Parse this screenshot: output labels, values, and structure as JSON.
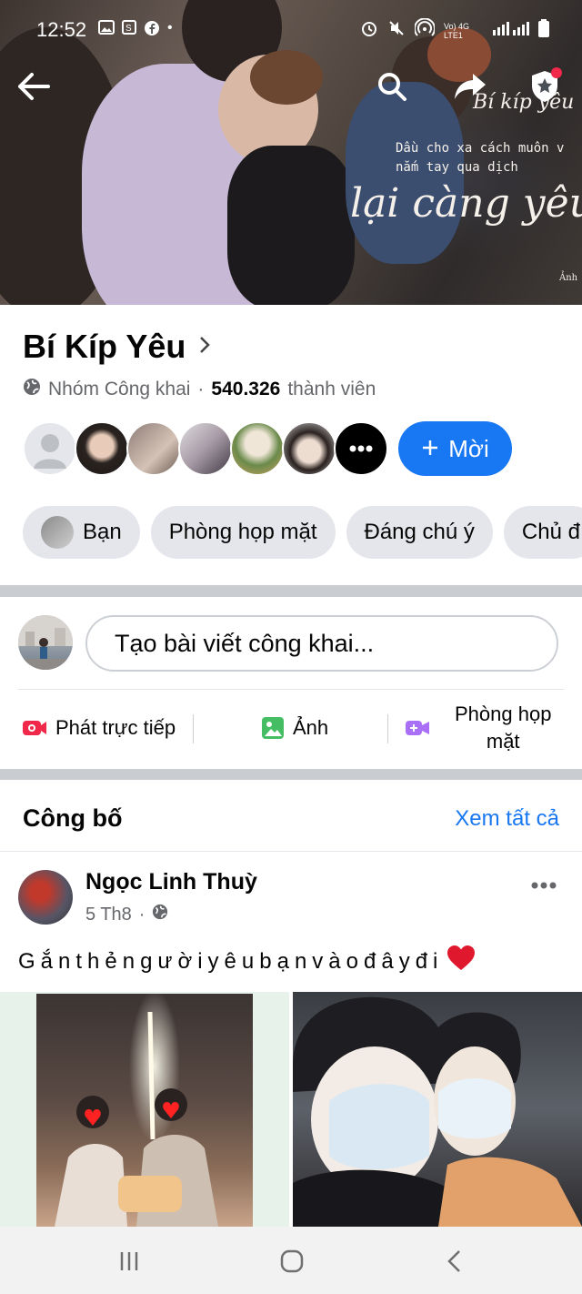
{
  "status_bar": {
    "time": "12:52",
    "network": "Vo) 4G LTE1"
  },
  "cover": {
    "script_title": "Bí kíp yêu",
    "line1": "Dầu cho xa cách muôn v",
    "line2": "nắm tay qua dịch",
    "line3": "lại càng yêu thư",
    "credit": "Ảnh"
  },
  "group": {
    "name": "Bí Kíp Yêu",
    "privacy": "Nhóm Công khai",
    "separator": "·",
    "member_count": "540.326",
    "member_label": "thành viên",
    "invite_label": "Mời"
  },
  "chips": [
    "Bạn",
    "Phòng họp mặt",
    "Đáng chú ý",
    "Chủ đ"
  ],
  "composer": {
    "placeholder": "Tạo bài viết công khai...",
    "actions": {
      "live": "Phát trực tiếp",
      "photo": "Ảnh",
      "room_line1": "Phòng họp",
      "room_line2": "mặt"
    }
  },
  "announcements": {
    "title": "Công bố",
    "see_all": "Xem tất cả"
  },
  "post": {
    "author": "Ngọc Linh Thuỳ",
    "date": "5 Th8",
    "text": "Gắnthẻngườiyêubạnvàođâyđi"
  },
  "colors": {
    "accent": "#1877f2",
    "chip_bg": "#e4e6eb",
    "live_red": "#f02849",
    "photo_green": "#45bd62",
    "room_purple": "#a970f7"
  }
}
